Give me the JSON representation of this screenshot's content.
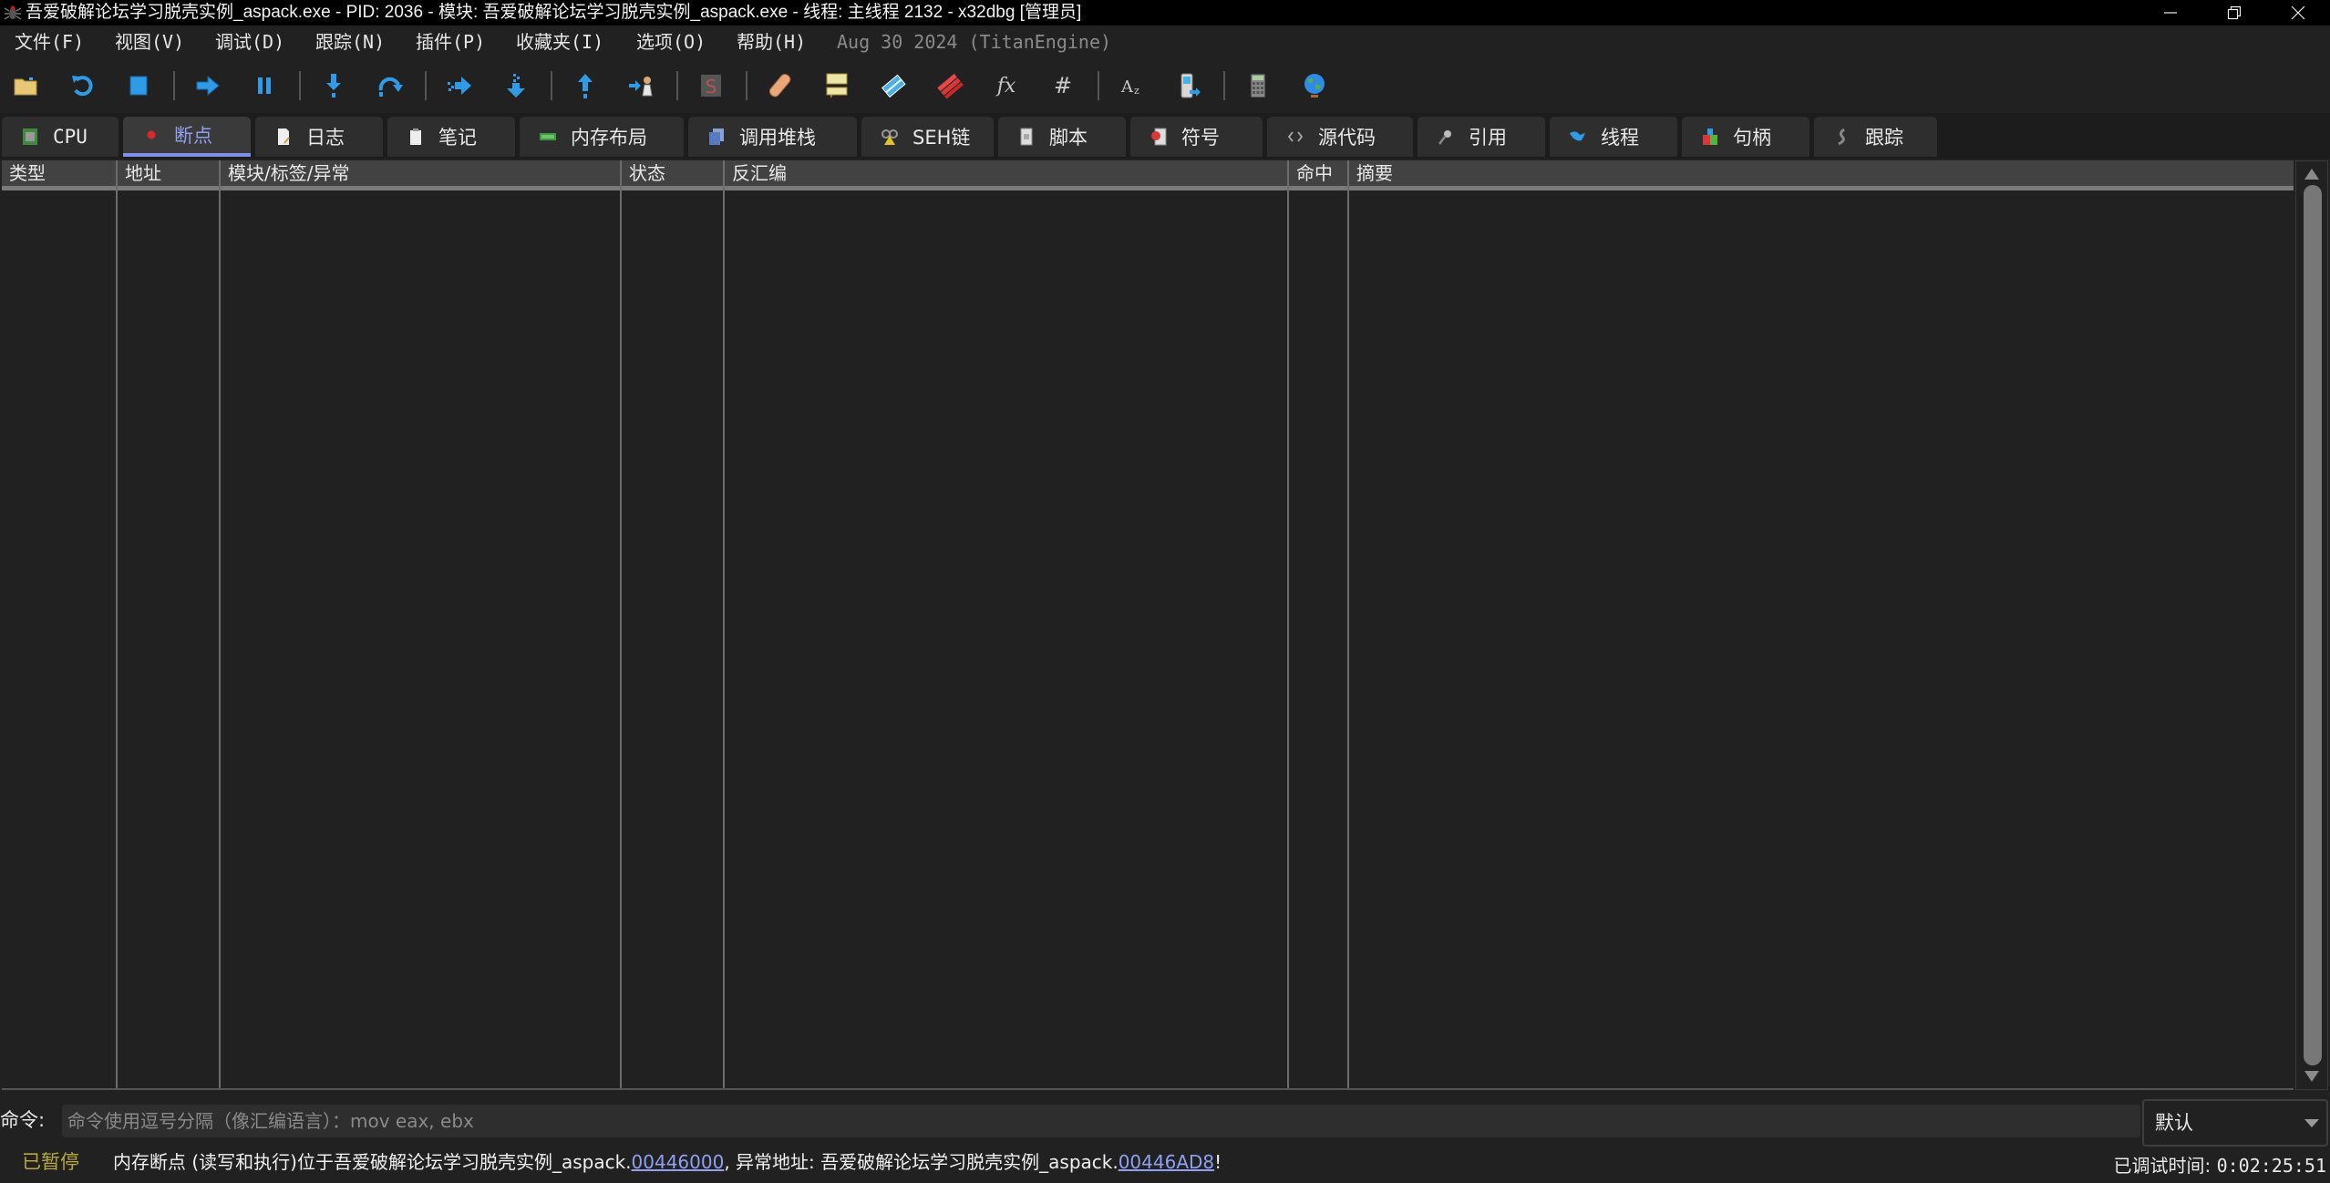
{
  "window": {
    "title": "吾爱破解论坛学习脱壳实例_aspack.exe - PID: 2036 - 模块: 吾爱破解论坛学习脱壳实例_aspack.exe - 线程: 主线程 2132 - x32dbg [管理员]",
    "icon": "bug-icon",
    "controls": [
      "minimize",
      "restore",
      "close"
    ]
  },
  "menu": {
    "items": [
      "文件(F)",
      "视图(V)",
      "调试(D)",
      "跟踪(N)",
      "插件(P)",
      "收藏夹(I)",
      "选项(O)",
      "帮助(H)"
    ],
    "build": "Aug 30 2024 (TitanEngine)"
  },
  "toolbar": {
    "buttons": [
      {
        "name": "open",
        "icon": "folder-icon"
      },
      {
        "name": "restart",
        "icon": "restart-icon"
      },
      {
        "name": "stop",
        "icon": "stop-icon"
      },
      {
        "name": "run",
        "icon": "run-arrow-icon"
      },
      {
        "name": "pause",
        "icon": "pause-icon"
      },
      {
        "name": "step-into",
        "icon": "step-into-icon"
      },
      {
        "name": "step-over",
        "icon": "step-over-icon"
      },
      {
        "name": "trace-into",
        "icon": "trace-into-icon"
      },
      {
        "name": "trace-over",
        "icon": "trace-over-icon"
      },
      {
        "name": "execute-till-return",
        "icon": "step-out-icon"
      },
      {
        "name": "run-to-user-code",
        "icon": "run-to-user-icon"
      },
      {
        "name": "scylla",
        "icon": "scylla-icon"
      },
      {
        "name": "patches",
        "icon": "bandage-icon"
      },
      {
        "name": "comments",
        "icon": "comments-icon"
      },
      {
        "name": "labels",
        "icon": "labels-icon"
      },
      {
        "name": "bookmarks",
        "icon": "bookmarks-icon"
      },
      {
        "name": "functions",
        "icon": "fx-icon"
      },
      {
        "name": "variables",
        "icon": "hash-icon"
      },
      {
        "name": "strings",
        "icon": "strings-az-icon"
      },
      {
        "name": "attach-device",
        "icon": "phone-icon"
      },
      {
        "name": "calculator",
        "icon": "calculator-icon"
      },
      {
        "name": "online-help",
        "icon": "globe-icon"
      }
    ]
  },
  "tabs": [
    {
      "label": "CPU",
      "icon": "cpu-icon",
      "active": false
    },
    {
      "label": "断点",
      "icon": "breakpoint-dot-icon",
      "active": true
    },
    {
      "label": "日志",
      "icon": "log-icon",
      "active": false
    },
    {
      "label": "笔记",
      "icon": "notes-icon",
      "active": false
    },
    {
      "label": "内存布局",
      "icon": "memory-icon",
      "active": false
    },
    {
      "label": "调用堆栈",
      "icon": "callstack-icon",
      "active": false
    },
    {
      "label": "SEH链",
      "icon": "seh-icon",
      "active": false
    },
    {
      "label": "脚本",
      "icon": "script-icon",
      "active": false
    },
    {
      "label": "符号",
      "icon": "symbols-icon",
      "active": false
    },
    {
      "label": "源代码",
      "icon": "source-code-icon",
      "active": false
    },
    {
      "label": "引用",
      "icon": "references-icon",
      "active": false
    },
    {
      "label": "线程",
      "icon": "threads-icon",
      "active": false
    },
    {
      "label": "句柄",
      "icon": "handles-icon",
      "active": false
    },
    {
      "label": "跟踪",
      "icon": "trace-icon",
      "active": false
    }
  ],
  "table": {
    "columns": [
      "类型",
      "地址",
      "模块/标签/异常",
      "状态",
      "反汇编",
      "命中",
      "摘要"
    ],
    "rows": []
  },
  "command": {
    "label": "命令:",
    "placeholder": "命令使用逗号分隔（像汇编语言）：mov eax, ebx",
    "value": "",
    "mode": "默认"
  },
  "status": {
    "state": "已暂停",
    "message_prefix": "内存断点 (读写和执行)位于吾爱破解论坛学习脱壳实例_aspack.",
    "address1": "00446000",
    "message_middle": ", 异常地址: 吾爱破解论坛学习脱壳实例_aspack.",
    "address2": "00446AD8",
    "message_suffix": "!",
    "elapsed_label": "已调试时间:",
    "elapsed_value": "0:02:25:51"
  },
  "colors": {
    "accent": "#7f8ee6",
    "paused": "#b8a83a",
    "background": "#212121",
    "header": "#424242"
  }
}
